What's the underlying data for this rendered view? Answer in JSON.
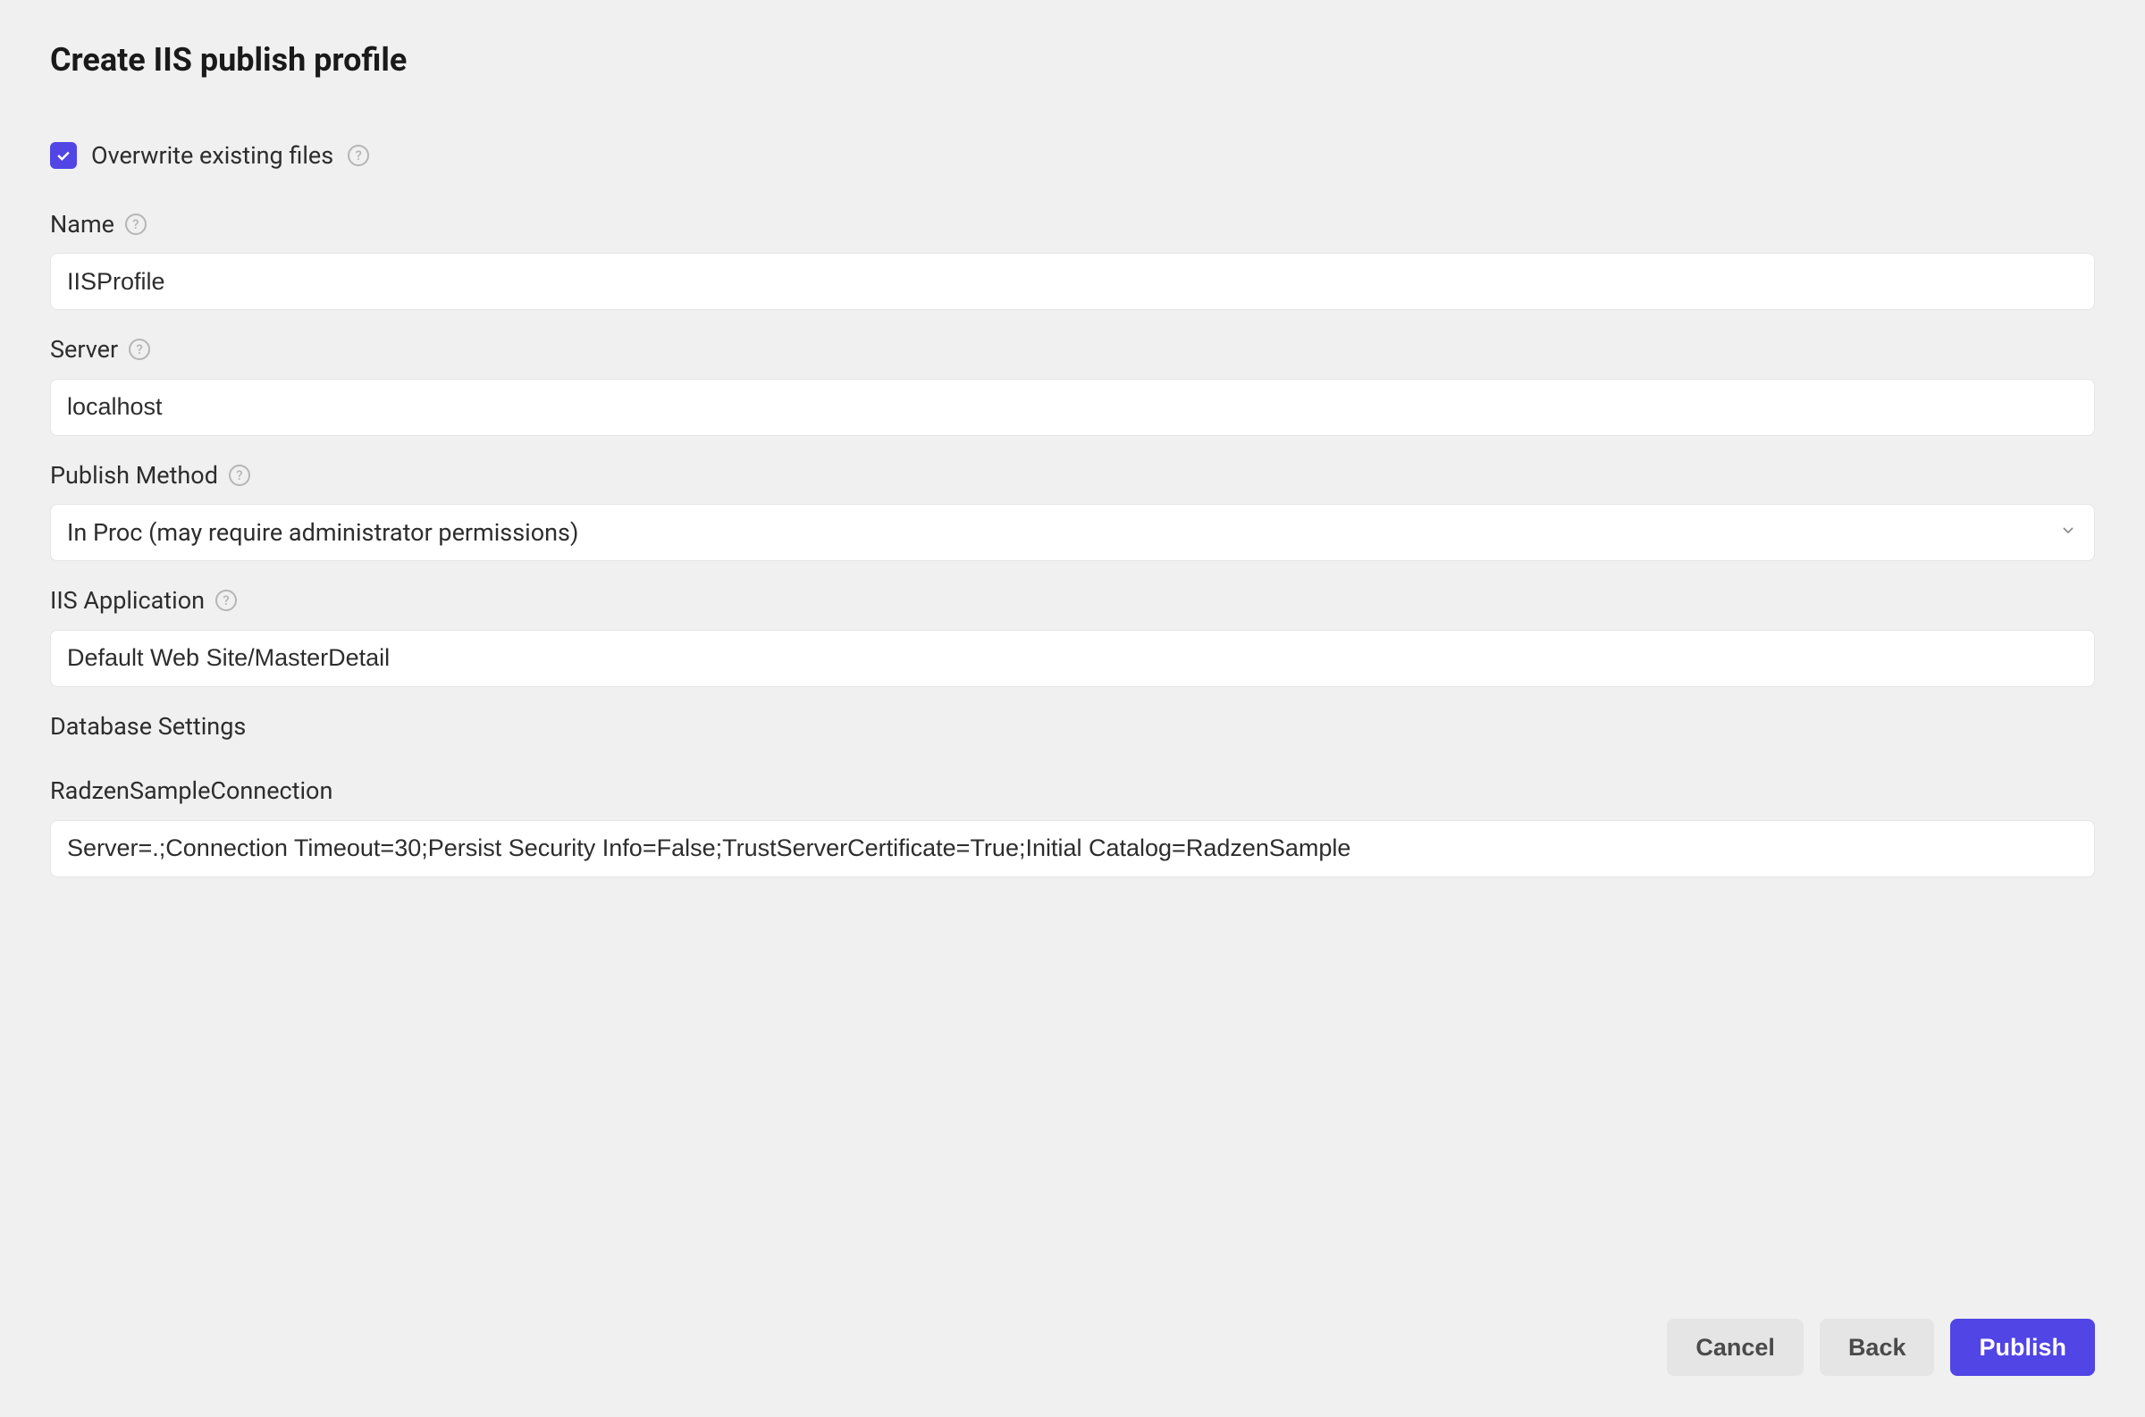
{
  "dialog": {
    "title": "Create IIS publish profile"
  },
  "overwrite": {
    "label": "Overwrite existing files",
    "checked": true
  },
  "fields": {
    "name": {
      "label": "Name",
      "value": "IISProfile"
    },
    "server": {
      "label": "Server",
      "value": "localhost"
    },
    "publishMethod": {
      "label": "Publish Method",
      "value": "In Proc (may require administrator permissions)"
    },
    "iisApplication": {
      "label": "IIS Application",
      "value": "Default Web Site/MasterDetail"
    }
  },
  "database": {
    "sectionLabel": "Database Settings",
    "connectionName": "RadzenSampleConnection",
    "connectionValue": "Server=.;Connection Timeout=30;Persist Security Info=False;TrustServerCertificate=True;Initial Catalog=RadzenSample"
  },
  "buttons": {
    "cancel": "Cancel",
    "back": "Back",
    "publish": "Publish"
  }
}
